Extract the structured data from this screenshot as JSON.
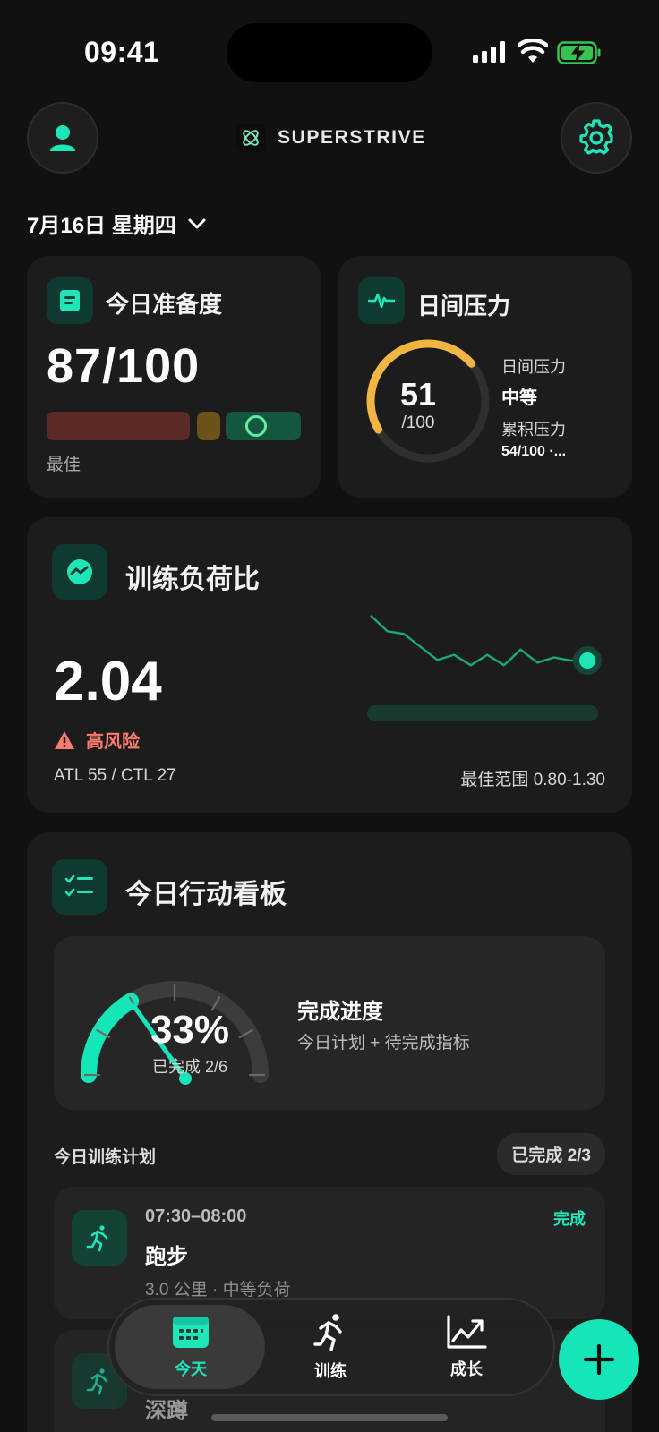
{
  "status": {
    "time": "09:41"
  },
  "header": {
    "brand": "SUPERSTRIVE"
  },
  "date": {
    "label": "7月16日 星期四"
  },
  "readiness": {
    "title": "今日准备度",
    "score": "87/100",
    "level": "最佳",
    "score_value": 87
  },
  "stress": {
    "title": "日间压力",
    "value": "51",
    "max": "/100",
    "gauge_value": 51,
    "daily_label": "日间压力",
    "daily_level": "中等",
    "cumulative_label": "累积压力",
    "cumulative_value": "54/100 ·..."
  },
  "ratio": {
    "title": "训练负荷比",
    "value": "2.04",
    "risk": "高风险",
    "atl_ctl": "ATL 55 / CTL 27",
    "optimal_range": "最佳范围 0.80-1.30",
    "chart_data": {
      "type": "line",
      "values": [
        2.9,
        2.6,
        2.55,
        2.3,
        2.05,
        2.15,
        1.95,
        2.15,
        1.95,
        2.25,
        2.0,
        2.1,
        2.04,
        2.04
      ]
    }
  },
  "board": {
    "title": "今日行动看板",
    "percent": "33%",
    "completed": "已完成 2/6",
    "progress_value": 0.33,
    "progress_title": "完成进度",
    "progress_subtitle": "今日计划 + 待完成指标",
    "plan_title": "今日训练计划",
    "plan_badge": "已完成 2/3",
    "tasks": [
      {
        "time": "07:30–08:00",
        "name": "跑步",
        "detail": "3.0 公里 · 中等负荷",
        "status": "完成"
      },
      {
        "name": "深蹲"
      }
    ]
  },
  "nav": {
    "tabs": [
      {
        "label": "今天"
      },
      {
        "label": "训练"
      },
      {
        "label": "成长"
      }
    ]
  },
  "colors": {
    "accent": "#1ee6b8",
    "warning": "#f1b642",
    "danger": "#ff7b6b"
  }
}
